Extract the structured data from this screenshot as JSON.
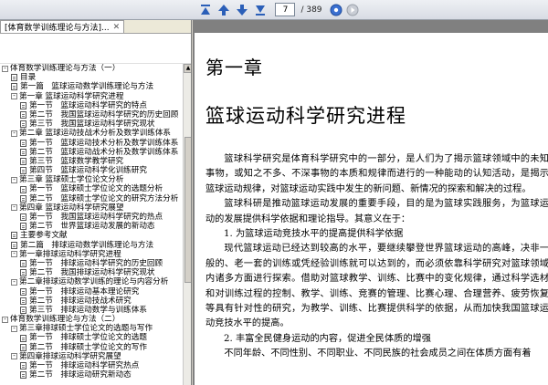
{
  "toolbar": {
    "current_page": "7",
    "total_pages": "/ 389",
    "icons": [
      "first-page-icon",
      "prev-page-icon",
      "next-page-icon",
      "last-page-icon",
      "back-icon",
      "forward-icon"
    ]
  },
  "tab": {
    "label": "[体育数学训练理论与方法]..."
  },
  "tree": {
    "items": [
      {
        "label": "体育数学训练理论与方法（一）",
        "level": 0,
        "expander": "-"
      },
      {
        "label": "目录",
        "level": 1,
        "expander": ""
      },
      {
        "label": "第一篇　篮球运动数学训练理论与方法",
        "level": 1,
        "expander": ""
      },
      {
        "label": "第一章 篮球运动科学研究进程",
        "level": 1,
        "expander": "-"
      },
      {
        "label": "第一节　篮球运动科学研究的特点",
        "level": 2,
        "expander": ""
      },
      {
        "label": "第二节　我国篮球运动科学研究的历史回顾",
        "level": 2,
        "expander": ""
      },
      {
        "label": "第三节　我国篮球运动科学研究现状",
        "level": 2,
        "expander": ""
      },
      {
        "label": "第二章 篮球运动技战术分析及数学训练体系",
        "level": 1,
        "expander": "-"
      },
      {
        "label": "第一节　篮球运动技术分析及数学训练体系",
        "level": 2,
        "expander": ""
      },
      {
        "label": "第二节　篮球运动战术分析及数学训练体系",
        "level": 2,
        "expander": ""
      },
      {
        "label": "第三节　篮球数学教学研究",
        "level": 2,
        "expander": ""
      },
      {
        "label": "第四节　篮球运动科学化训练研究",
        "level": 2,
        "expander": ""
      },
      {
        "label": "第三章 篮球硕士学位论文分析",
        "level": 1,
        "expander": "-"
      },
      {
        "label": "第一节　篮球硕士学位论文的选题分析",
        "level": 2,
        "expander": ""
      },
      {
        "label": "第二节　篮球硕士学位论文的研究方法分析",
        "level": 2,
        "expander": ""
      },
      {
        "label": "第四章 篮球运动科学研究展望",
        "level": 1,
        "expander": "-"
      },
      {
        "label": "第一节　我国篮球运动科学研究的热点",
        "level": 2,
        "expander": ""
      },
      {
        "label": "第二节　世界篮球运动发展的新动态",
        "level": 2,
        "expander": ""
      },
      {
        "label": "主要参考文献",
        "level": 1,
        "expander": ""
      },
      {
        "label": "第二篇　排球运动数学训练理论与方法",
        "level": 1,
        "expander": ""
      },
      {
        "label": "第一章排球运动科学研究进程",
        "level": 1,
        "expander": "-"
      },
      {
        "label": "第一节　排球运动科学研究的历史回顾",
        "level": 2,
        "expander": ""
      },
      {
        "label": "第二节　我国排球运动科学研究现状",
        "level": 2,
        "expander": ""
      },
      {
        "label": "第二章排球运动数学训练的理论与内容分析",
        "level": 1,
        "expander": "-"
      },
      {
        "label": "第一节　排球运动基本理论研究",
        "level": 2,
        "expander": ""
      },
      {
        "label": "第二节　排球运动技战术研究",
        "level": 2,
        "expander": ""
      },
      {
        "label": "第三节　排球运动数学与训练体系",
        "level": 2,
        "expander": ""
      },
      {
        "label": "体育数学训练理论与方法（二）",
        "level": 0,
        "expander": "-"
      },
      {
        "label": "第三章排球硕士学位论文的选题与写作",
        "level": 1,
        "expander": "-"
      },
      {
        "label": "第一节　排球硕士学位论文的选题",
        "level": 2,
        "expander": ""
      },
      {
        "label": "第二节　排球硕士学位论文的写作",
        "level": 2,
        "expander": ""
      },
      {
        "label": "第四章排球运动科学研究展望",
        "level": 1,
        "expander": "-"
      },
      {
        "label": "第一节　排球运动科学研究热点",
        "level": 2,
        "expander": ""
      },
      {
        "label": "第二节　排球运动研究新动态",
        "level": 2,
        "expander": ""
      }
    ]
  },
  "document": {
    "chapter": "第一章",
    "title": "篮球运动科学研究进程",
    "paragraphs": [
      {
        "type": "para",
        "text": "篮球科学研究是体育科学研究中的一部分，是人们为了揭示篮球领域中的未知事物，或知之不多、不深事物的本质和规律而进行的一种能动的认知活动，是揭示篮球运动规律，对篮球运动实践中发生的新问题、新情况的探索和解决的过程。"
      },
      {
        "type": "para",
        "text": "篮球科研是推动篮球运动发展的重要手段，目的是为篮球实践服务，为篮球运动的发展提供科学依据和理论指导。其意义在于："
      },
      {
        "type": "sub",
        "text": "1. 为篮球运动竞技水平的提高提供科学依据"
      },
      {
        "type": "para",
        "text": "现代篮球运动已经达到较高的水平，要继续攀登世界篮球运动的高峰，决非一般的、老一套的训练或凭经验训练就可以达到的，而必须依靠科学研究对篮球领域内诸多方面进行探索。借助对篮球教学、训练、比赛中的变化规律，通过科学选材和对训练过程的控制、教学、训练、竞赛的管理、比赛心理、合理营养、疲劳恢复等具有针对性的研究，为教学、训练、比赛提供科学的依据，从而加快我国篮球运动竞技水平的提高。"
      },
      {
        "type": "sub",
        "text": "2. 丰富全民健身运动的内容，促进全民体质的增强"
      },
      {
        "type": "para",
        "text": "不同年龄、不同性别、不同职业、不同民族的社会成员之间在体质方面有着"
      }
    ]
  }
}
